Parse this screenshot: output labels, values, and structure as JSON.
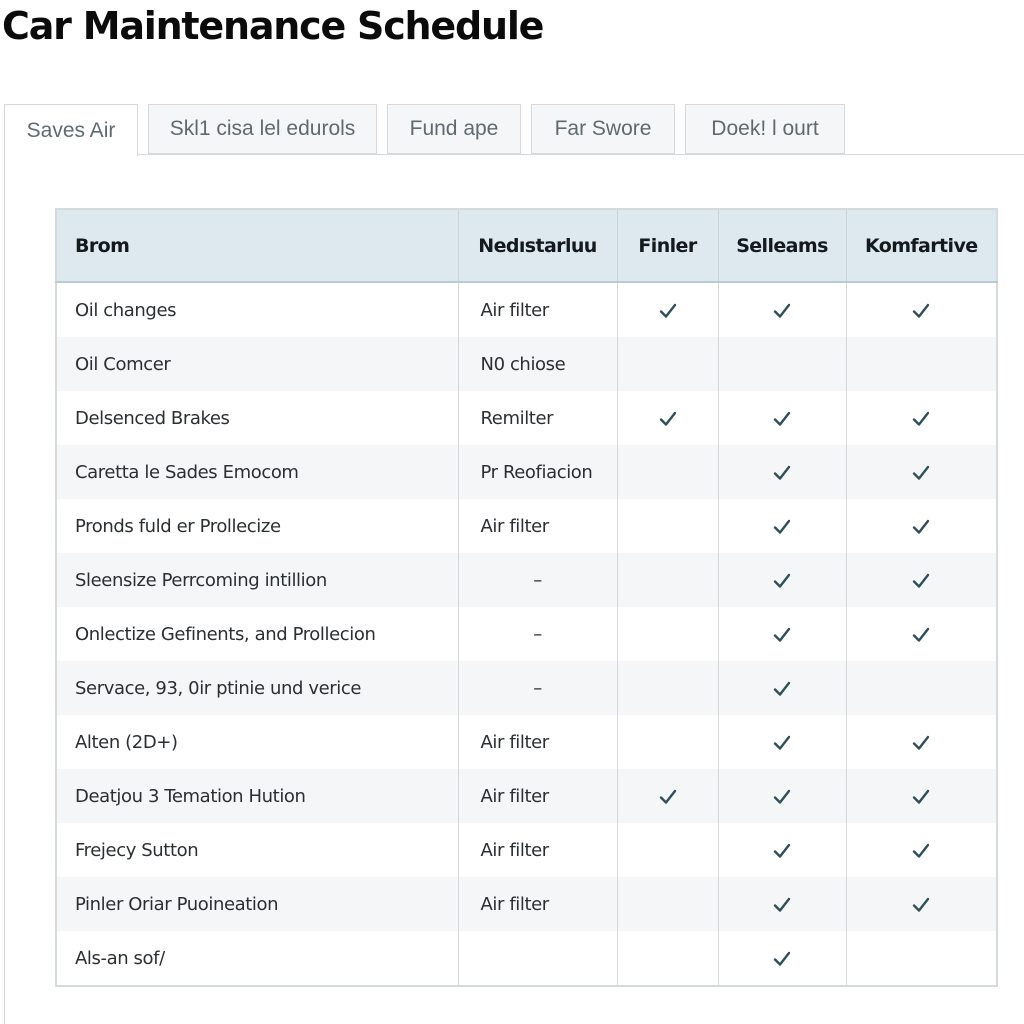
{
  "page": {
    "title": "Car Maintenance Schedule"
  },
  "tabs": [
    {
      "label": "Saves Air",
      "active": true
    },
    {
      "label": "Skl1 cisa lel edurols",
      "active": false
    },
    {
      "label": "Fund ape",
      "active": false
    },
    {
      "label": "Far Swore",
      "active": false
    },
    {
      "label": "Doek! l ourt",
      "active": false
    }
  ],
  "table": {
    "columns": [
      "Brom",
      "Nedıstarluu",
      "Finler",
      "Selleams",
      "Komfartive"
    ],
    "rows": [
      {
        "item": "Oil changes",
        "note": "Air filter",
        "checks": [
          true,
          true,
          true
        ]
      },
      {
        "item": "Oil Comcer",
        "note": "N0 chiose",
        "checks": [
          false,
          false,
          false
        ]
      },
      {
        "item": "Delsenced Brakes",
        "note": "Remilter",
        "checks": [
          true,
          true,
          true
        ]
      },
      {
        "item": "Caretta le Sades Emocom",
        "note": "Pr Reofiacion",
        "checks": [
          false,
          true,
          true
        ]
      },
      {
        "item": "Pronds fuld er Prollecize",
        "note": "Air filter",
        "checks": [
          false,
          true,
          true
        ]
      },
      {
        "item": "Sleensize Perrcoming intillion",
        "note": "–",
        "checks": [
          false,
          true,
          true
        ]
      },
      {
        "item": "Onlectize Gefinents, and Prollecion",
        "note": "–",
        "checks": [
          false,
          true,
          true
        ]
      },
      {
        "item": "Servace, 93, 0ir ptinie und verice",
        "note": "–",
        "checks": [
          false,
          true,
          false
        ]
      },
      {
        "item": "Alten (2D+)",
        "note": "Air filter",
        "checks": [
          false,
          true,
          true
        ]
      },
      {
        "item": "Deatjou 3 Temation Hution",
        "note": "Air filter",
        "checks": [
          true,
          true,
          true
        ]
      },
      {
        "item": "Frejecy Sutton",
        "note": "Air filter",
        "checks": [
          false,
          true,
          true
        ]
      },
      {
        "item": "Pinler Oriar Puoineation",
        "note": "Air filter",
        "checks": [
          false,
          true,
          true
        ]
      },
      {
        "item": "Als-an sof/",
        "note": "",
        "checks": [
          false,
          true,
          false
        ]
      }
    ]
  },
  "icons": {
    "check": "check-icon"
  },
  "colors": {
    "header_bg": "#dde9ef",
    "check": "#2f4f5a",
    "row_alt": "#f4f6f7",
    "border": "#d5d9db"
  }
}
